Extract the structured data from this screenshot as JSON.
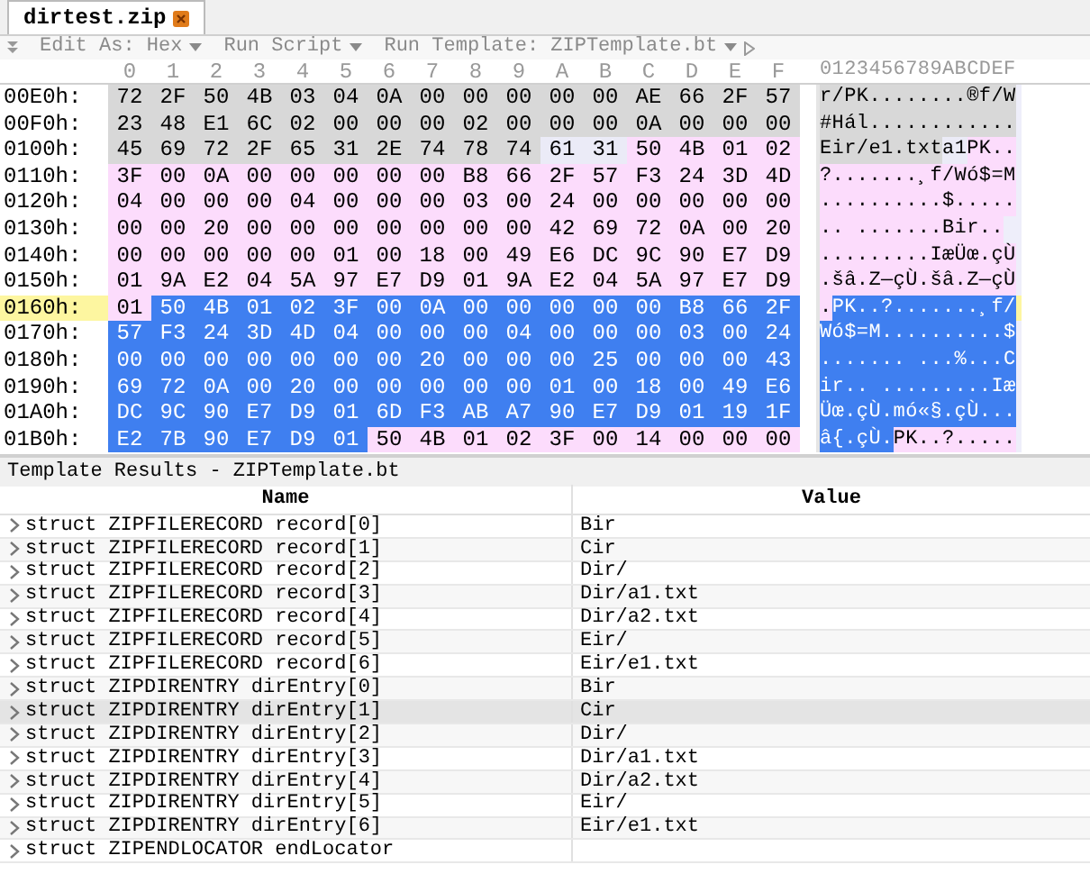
{
  "tab": {
    "title": "dirtest.zip"
  },
  "toolbar": [
    {
      "label": "Edit As: Hex",
      "dropdown": true
    },
    {
      "label": "Run Script",
      "dropdown": true
    },
    {
      "label": "Run Template: ZIPTemplate.bt",
      "dropdown": true
    }
  ],
  "hex_header": {
    "columns": [
      "0",
      "1",
      "2",
      "3",
      "4",
      "5",
      "6",
      "7",
      "8",
      "9",
      "A",
      "B",
      "C",
      "D",
      "E",
      "F"
    ],
    "ascii": "0123456789ABCDEF"
  },
  "hex_rows": [
    {
      "address": "00E0h:",
      "current": false,
      "segments": [
        {
          "kind": "file_record",
          "bytes": [
            "72",
            "2F",
            "50",
            "4B",
            "03",
            "04",
            "0A",
            "00",
            "00",
            "00",
            "00",
            "00",
            "AE",
            "66",
            "2F",
            "57"
          ],
          "ascii": "r/PK........®f/W"
        }
      ]
    },
    {
      "address": "00F0h:",
      "current": false,
      "segments": [
        {
          "kind": "file_record",
          "bytes": [
            "23",
            "48",
            "E1",
            "6C",
            "02",
            "00",
            "00",
            "00",
            "02",
            "00",
            "00",
            "00",
            "0A",
            "00",
            "00",
            "00"
          ],
          "ascii": "#Hál............"
        }
      ]
    },
    {
      "address": "0100h:",
      "current": false,
      "segments": [
        {
          "kind": "file_record",
          "bytes": [
            "45",
            "69",
            "72",
            "2F",
            "65",
            "31",
            "2E",
            "74",
            "78",
            "74"
          ],
          "ascii": "Eir/e1.txt"
        },
        {
          "kind": "data",
          "bytes": [
            "61",
            "31"
          ],
          "ascii": "a1"
        },
        {
          "kind": "dir_entry",
          "bytes": [
            "50",
            "4B",
            "01",
            "02"
          ],
          "ascii": "PK.."
        }
      ]
    },
    {
      "address": "0110h:",
      "current": false,
      "segments": [
        {
          "kind": "dir_entry",
          "bytes": [
            "3F",
            "00",
            "0A",
            "00",
            "00",
            "00",
            "00",
            "00",
            "B8",
            "66",
            "2F",
            "57",
            "F3",
            "24",
            "3D",
            "4D"
          ],
          "ascii": "?.......¸f/Wó$=M"
        }
      ]
    },
    {
      "address": "0120h:",
      "current": false,
      "segments": [
        {
          "kind": "dir_entry",
          "bytes": [
            "04",
            "00",
            "00",
            "00",
            "04",
            "00",
            "00",
            "00",
            "03",
            "00",
            "24",
            "00",
            "00",
            "00",
            "00",
            "00"
          ],
          "ascii": "..........$....."
        }
      ]
    },
    {
      "address": "0130h:",
      "current": false,
      "segments": [
        {
          "kind": "dir_entry",
          "bytes": [
            "00",
            "00",
            "20",
            "00",
            "00",
            "00",
            "00",
            "00",
            "00",
            "00",
            "42",
            "69",
            "72",
            "0A",
            "00",
            "20"
          ],
          "ascii": ".. .......Bir.."
        }
      ]
    },
    {
      "address": "0140h:",
      "current": false,
      "segments": [
        {
          "kind": "dir_entry",
          "bytes": [
            "00",
            "00",
            "00",
            "00",
            "00",
            "01",
            "00",
            "18",
            "00",
            "49",
            "E6",
            "DC",
            "9C",
            "90",
            "E7",
            "D9"
          ],
          "ascii": ".........IæÜœ.çÙ"
        }
      ]
    },
    {
      "address": "0150h:",
      "current": false,
      "segments": [
        {
          "kind": "dir_entry",
          "bytes": [
            "01",
            "9A",
            "E2",
            "04",
            "5A",
            "97",
            "E7",
            "D9",
            "01",
            "9A",
            "E2",
            "04",
            "5A",
            "97",
            "E7",
            "D9"
          ],
          "ascii": ".šâ.Z—çÙ.šâ.Z—çÙ"
        }
      ]
    },
    {
      "address": "0160h:",
      "current": true,
      "segments": [
        {
          "kind": "dir_entry",
          "bytes": [
            "01"
          ],
          "ascii": "."
        },
        {
          "kind": "selected",
          "bytes": [
            "50",
            "4B",
            "01",
            "02",
            "3F",
            "00",
            "0A",
            "00",
            "00",
            "00",
            "00",
            "00",
            "B8",
            "66",
            "2F"
          ],
          "ascii": "PK..?.......¸f/"
        }
      ]
    },
    {
      "address": "0170h:",
      "current": false,
      "segments": [
        {
          "kind": "selected",
          "bytes": [
            "57",
            "F3",
            "24",
            "3D",
            "4D",
            "04",
            "00",
            "00",
            "00",
            "04",
            "00",
            "00",
            "00",
            "03",
            "00",
            "24"
          ],
          "ascii": "Wó$=M..........$"
        }
      ]
    },
    {
      "address": "0180h:",
      "current": false,
      "segments": [
        {
          "kind": "selected",
          "bytes": [
            "00",
            "00",
            "00",
            "00",
            "00",
            "00",
            "00",
            "20",
            "00",
            "00",
            "00",
            "25",
            "00",
            "00",
            "00",
            "43"
          ],
          "ascii": "....... ...%...C"
        }
      ]
    },
    {
      "address": "0190h:",
      "current": false,
      "segments": [
        {
          "kind": "selected",
          "bytes": [
            "69",
            "72",
            "0A",
            "00",
            "20",
            "00",
            "00",
            "00",
            "00",
            "00",
            "01",
            "00",
            "18",
            "00",
            "49",
            "E6"
          ],
          "ascii": "ir.. .........Iæ"
        }
      ]
    },
    {
      "address": "01A0h:",
      "current": false,
      "segments": [
        {
          "kind": "selected",
          "bytes": [
            "DC",
            "9C",
            "90",
            "E7",
            "D9",
            "01",
            "6D",
            "F3",
            "AB",
            "A7",
            "90",
            "E7",
            "D9",
            "01",
            "19",
            "1F"
          ],
          "ascii": "Üœ.çÙ.mó«§.çÙ..."
        }
      ]
    },
    {
      "address": "01B0h:",
      "current": false,
      "segments": [
        {
          "kind": "selected",
          "bytes": [
            "E2",
            "7B",
            "90",
            "E7",
            "D9",
            "01"
          ],
          "ascii": "â{.çÙ."
        },
        {
          "kind": "dir_entry",
          "bytes": [
            "50",
            "4B",
            "01",
            "02",
            "3F",
            "00",
            "14",
            "00",
            "00",
            "00"
          ],
          "ascii": "PK..?....."
        }
      ]
    }
  ],
  "template_results": {
    "title": "Template Results - ZIPTemplate.bt",
    "columns": [
      "Name",
      "Value"
    ],
    "rows": [
      {
        "name": "struct ZIPFILERECORD record[0]",
        "value": "Bir",
        "expanded": false,
        "selected": false
      },
      {
        "name": "struct ZIPFILERECORD record[1]",
        "value": "Cir",
        "expanded": false,
        "selected": false
      },
      {
        "name": "struct ZIPFILERECORD record[2]",
        "value": "Dir/",
        "expanded": false,
        "selected": false
      },
      {
        "name": "struct ZIPFILERECORD record[3]",
        "value": "Dir/a1.txt",
        "expanded": false,
        "selected": false
      },
      {
        "name": "struct ZIPFILERECORD record[4]",
        "value": "Dir/a2.txt",
        "expanded": false,
        "selected": false
      },
      {
        "name": "struct ZIPFILERECORD record[5]",
        "value": "Eir/",
        "expanded": false,
        "selected": false
      },
      {
        "name": "struct ZIPFILERECORD record[6]",
        "value": "Eir/e1.txt",
        "expanded": false,
        "selected": false
      },
      {
        "name": "struct ZIPDIRENTRY dirEntry[0]",
        "value": "Bir",
        "expanded": false,
        "selected": false
      },
      {
        "name": "struct ZIPDIRENTRY dirEntry[1]",
        "value": "Cir",
        "expanded": false,
        "selected": true
      },
      {
        "name": "struct ZIPDIRENTRY dirEntry[2]",
        "value": "Dir/",
        "expanded": false,
        "selected": false
      },
      {
        "name": "struct ZIPDIRENTRY dirEntry[3]",
        "value": "Dir/a1.txt",
        "expanded": false,
        "selected": false
      },
      {
        "name": "struct ZIPDIRENTRY dirEntry[4]",
        "value": "Dir/a2.txt",
        "expanded": false,
        "selected": false
      },
      {
        "name": "struct ZIPDIRENTRY dirEntry[5]",
        "value": "Eir/",
        "expanded": false,
        "selected": false
      },
      {
        "name": "struct ZIPDIRENTRY dirEntry[6]",
        "value": "Eir/e1.txt",
        "expanded": false,
        "selected": false
      },
      {
        "name": "struct ZIPENDLOCATOR endLocator",
        "value": "",
        "expanded": false,
        "selected": false
      }
    ]
  }
}
